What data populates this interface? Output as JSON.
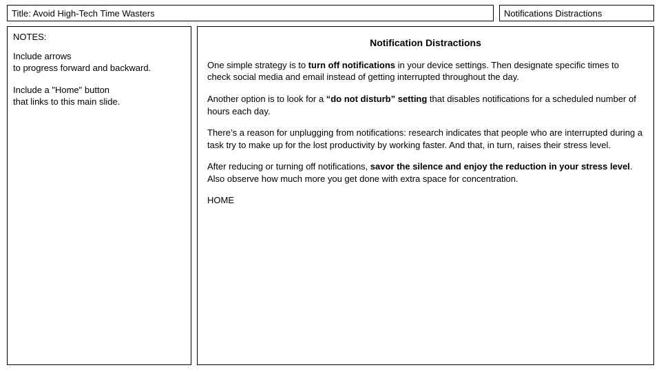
{
  "header": {
    "title": "Title: Avoid High-Tech Time Wasters",
    "topic": "Notifications Distractions"
  },
  "notes": {
    "heading": "NOTES:",
    "line1a": "Include arrows",
    "line1b": "to progress forward and backward.",
    "line2a": "Include a \"Home\" button",
    "line2b": "that links to this main slide."
  },
  "content": {
    "heading": "Notification Distractions",
    "p1a": "One simple strategy is to ",
    "p1b": "turn off notifications",
    "p1c": " in your device settings. Then designate specific times to check social media and email instead of getting interrupted throughout the day.",
    "p2a": "Another option is to look for a ",
    "p2b": "“do not disturb” setting",
    "p2c": " that disables notifications for a scheduled number of hours each day.",
    "p3": "There’s a reason for unplugging from notifications: research indicates that people who are interrupted during a task try to make up for the lost productivity by working faster. And that, in turn, raises their stress level.",
    "p4a": "After reducing or turning off notifications, ",
    "p4b": "savor the silence and enjoy the reduction in your stress level",
    "p4c": ". Also observe how much more you get done with extra space for concentration.",
    "home": "HOME"
  }
}
